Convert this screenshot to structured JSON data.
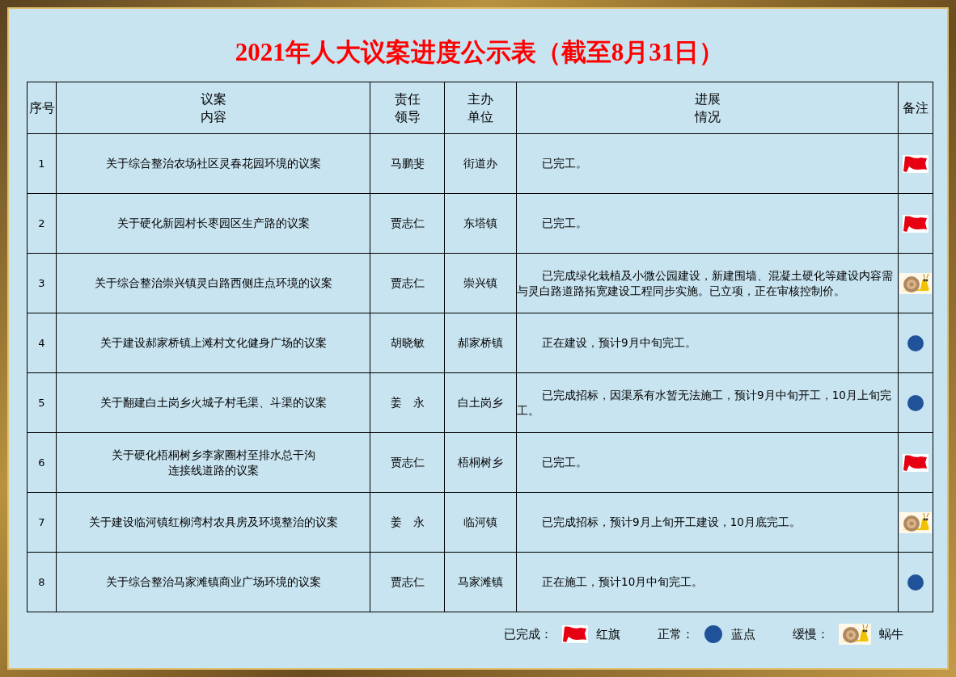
{
  "title": "2021年人大议案进度公示表（截至8月31日）",
  "table": {
    "columns": [
      "序号",
      "议案内容",
      "责任领导",
      "主办单位",
      "进展情况",
      "备注"
    ],
    "rows": [
      {
        "no": "1",
        "content": [
          "关于综合整治农场社区灵春花园环境的议案"
        ],
        "leader": "马鹏斐",
        "unit": "街道办",
        "progress": "已完工。",
        "kind": "flag"
      },
      {
        "no": "2",
        "content": [
          "关于硬化新园村长枣园区生产路的议案"
        ],
        "leader": "贾志仁",
        "unit": "东塔镇",
        "progress": "已完工。",
        "kind": "flag"
      },
      {
        "no": "3",
        "content": [
          "关于综合整治崇兴镇灵白路西侧庄点环境的议案"
        ],
        "leader": "贾志仁",
        "unit": "崇兴镇",
        "progress": "已完成绿化栽植及小微公园建设，新建围墙、混凝土硬化等建设内容需与灵白路道路拓宽建设工程同步实施。已立项，正在审核控制价。",
        "kind": "snail"
      },
      {
        "no": "4",
        "content": [
          "关于建设郝家桥镇上滩村文化健身广场的议案"
        ],
        "leader": "胡晓敏",
        "unit": "郝家桥镇",
        "progress": "正在建设，预计9月中旬完工。",
        "kind": "dot"
      },
      {
        "no": "5",
        "content": [
          "关于翻建白土岗乡火城子村毛渠、斗渠的议案"
        ],
        "leader": "姜　永",
        "unit": "白土岗乡",
        "progress": "已完成招标，因渠系有水暂无法施工，预计9月中旬开工，10月上旬完工。",
        "kind": "dot"
      },
      {
        "no": "6",
        "content": [
          "关于硬化梧桐树乡李家圈村至排水总干沟",
          "连接线道路的议案"
        ],
        "leader": "贾志仁",
        "unit": "梧桐树乡",
        "progress": "已完工。",
        "kind": "flag"
      },
      {
        "no": "7",
        "content": [
          "关于建设临河镇红柳湾村农具房及环境整治的议案"
        ],
        "leader": "姜　永",
        "unit": "临河镇",
        "progress": "已完成招标，预计9月上旬开工建设，10月底完工。",
        "kind": "snail"
      },
      {
        "no": "8",
        "content": [
          "关于综合整治马家滩镇商业广场环境的议案"
        ],
        "leader": "贾志仁",
        "unit": "马家滩镇",
        "progress": "正在施工，预计10月中旬完工。",
        "kind": "dot"
      }
    ]
  },
  "legend": [
    {
      "label": "已完成：",
      "kind": "flag",
      "name": "红旗"
    },
    {
      "label": "正常：",
      "kind": "dot",
      "name": "蓝点"
    },
    {
      "label": "缓慢：",
      "kind": "snail",
      "name": "蜗牛"
    }
  ]
}
